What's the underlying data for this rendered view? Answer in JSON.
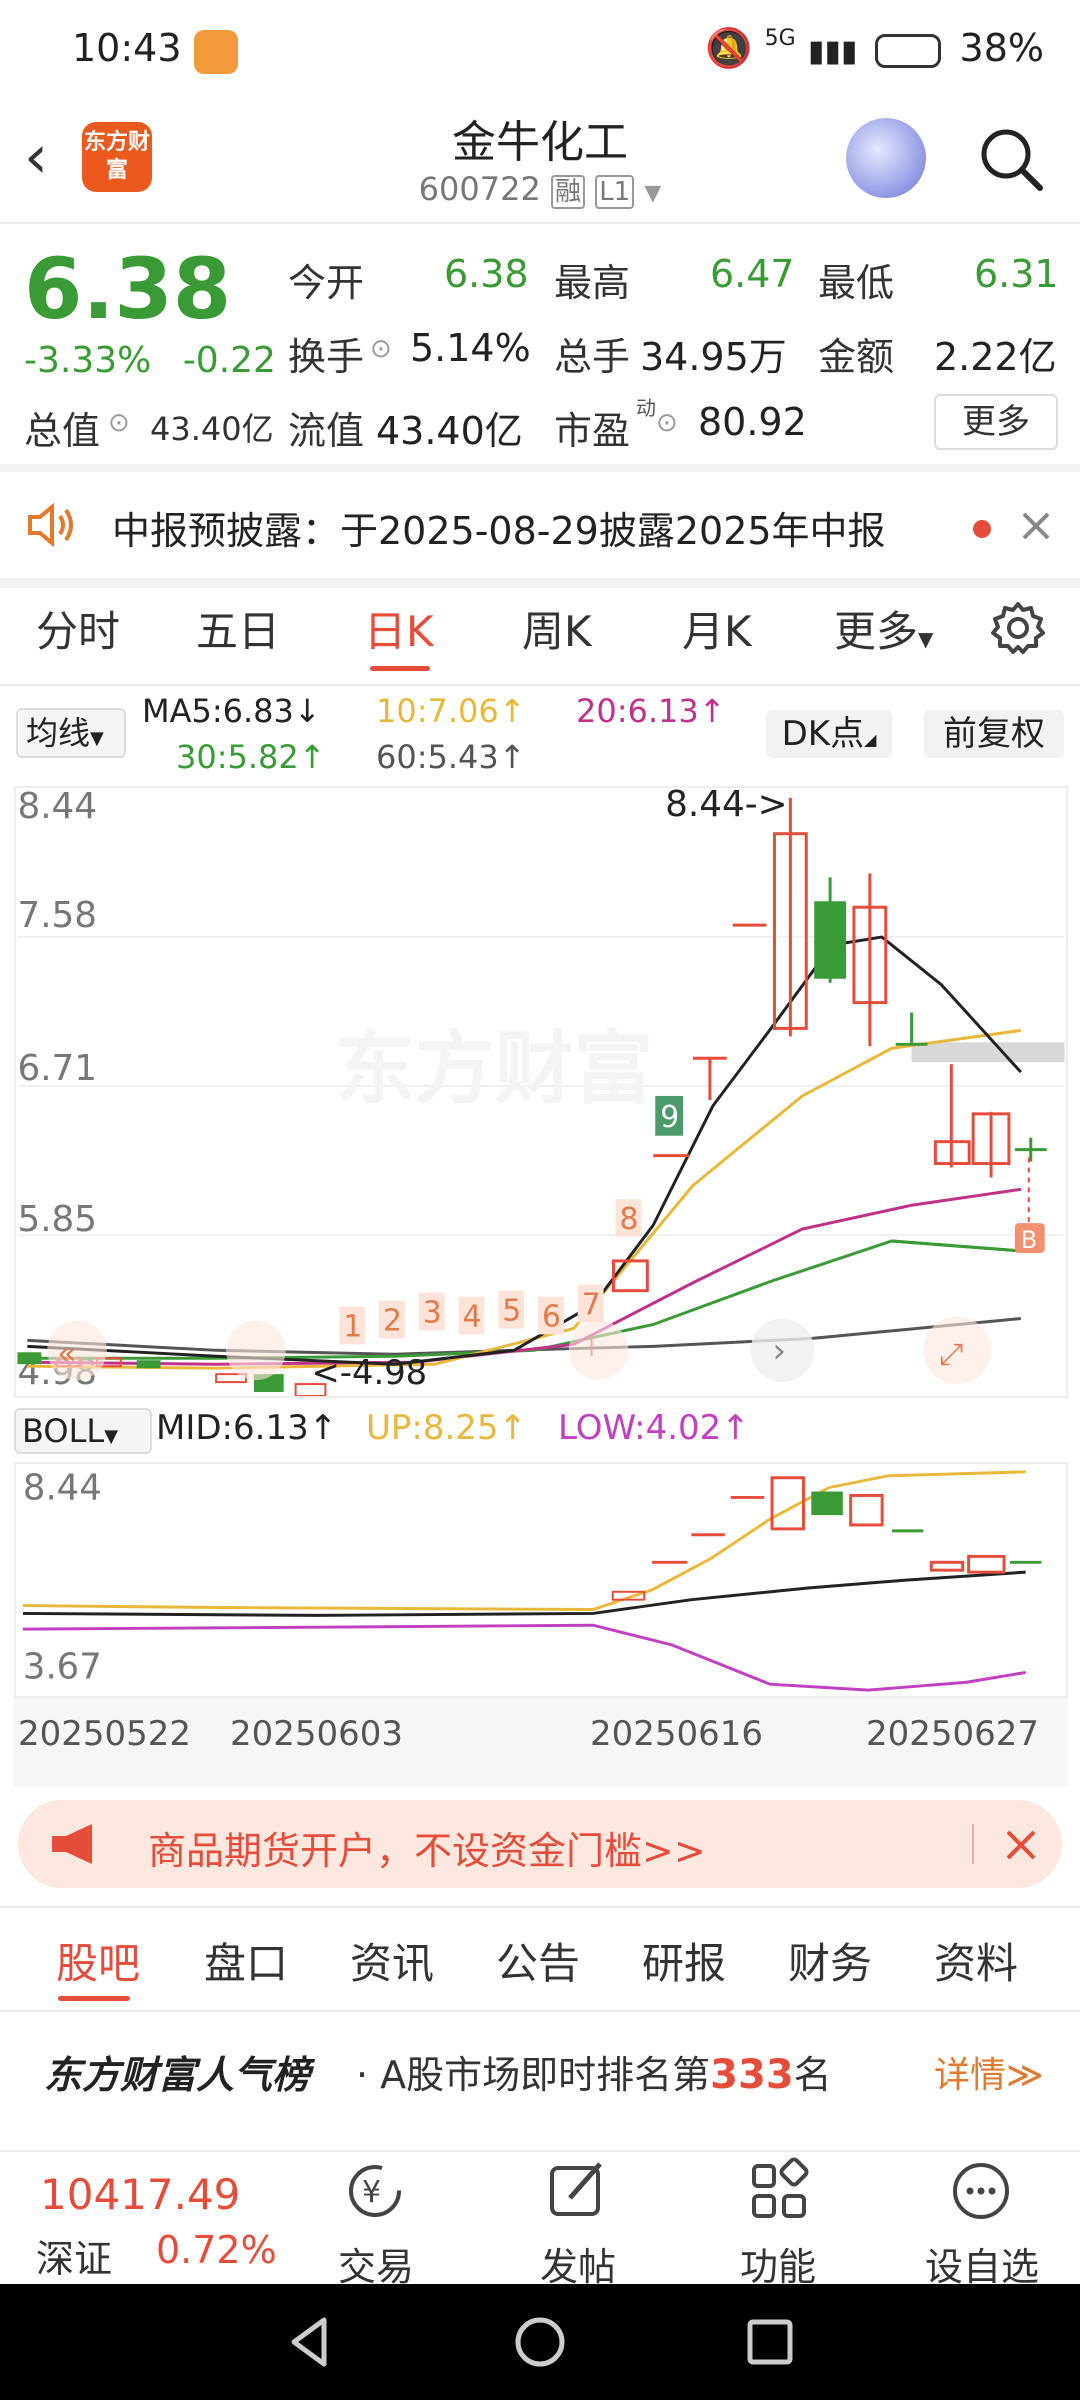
{
  "status_bar": {
    "time": "10:43",
    "battery": "38%",
    "network": "5G"
  },
  "header": {
    "logo_text": "东方财富",
    "stock_name": "金牛化工",
    "stock_code": "600722",
    "tag_margin": "融",
    "tag_level": "L1"
  },
  "quote": {
    "price": "6.38",
    "change_pct": "-3.33%",
    "change_abs": "-0.22",
    "open_label": "今开",
    "open": "6.38",
    "high_label": "最高",
    "high": "6.47",
    "low_label": "最低",
    "low": "6.31",
    "turnover_label": "换手",
    "turnover": "5.14%",
    "volume_label": "总手",
    "volume": "34.95万",
    "amount_label": "金额",
    "amount": "2.22亿",
    "mktcap_label": "总值",
    "mktcap": "43.40亿",
    "float_label": "流值",
    "float_cap": "43.40亿",
    "pe_label": "市盈",
    "pe_sup": "动",
    "pe": "80.92",
    "more_label": "更多"
  },
  "notice": {
    "text": "中报预披露：于2025-08-29披露2025年中报"
  },
  "chart_tabs": [
    "分时",
    "五日",
    "日K",
    "周K",
    "月K",
    "更多"
  ],
  "active_chart_tab": "日K",
  "ma_bar": {
    "selector": "均线",
    "ma5": "MA5:6.83↓",
    "ma10": "10:7.06↑",
    "ma20": "20:6.13↑",
    "ma30": "30:5.82↑",
    "ma60": "60:5.43↑",
    "dk_button": "DK点",
    "adjust_button": "前复权"
  },
  "kline": {
    "y_max_label": "8.44",
    "y_labels": [
      "8.44",
      "7.58",
      "6.71",
      "5.85",
      "4.98"
    ],
    "max_annotation": "8.44->",
    "min_annotation": "<-4.98",
    "dk_marks": [
      "1",
      "2",
      "3",
      "4",
      "5",
      "6",
      "7",
      "8",
      "9"
    ],
    "b_mark": "B",
    "watermark": "东方财富"
  },
  "boll_bar": {
    "selector": "BOLL",
    "mid": "MID:6.13↑",
    "up": "UP:8.25↑",
    "low": "LOW:4.02↑"
  },
  "boll": {
    "y_top": "8.44",
    "y_bottom": "3.67",
    "dates": [
      "20250522",
      "20250603",
      "20250616",
      "20250627"
    ]
  },
  "ad": {
    "text": "商品期货开户，不设资金门槛>>"
  },
  "bottom_tabs": [
    "股吧",
    "盘口",
    "资讯",
    "公告",
    "研报",
    "财务",
    "资料"
  ],
  "active_bottom_tab": "股吧",
  "rank": {
    "brand": "东方财富人气榜",
    "prefix": "· A股市场即时排名第",
    "number": "333",
    "suffix": "名",
    "detail": "详情≫"
  },
  "index": {
    "value": "10417.49",
    "name": "深证",
    "pct": "0.72%"
  },
  "nav_items": [
    "交易",
    "发帖",
    "功能",
    "设自选"
  ],
  "colors": {
    "up": "#e54c3a",
    "down": "#3a9a35",
    "accent": "#e54c3a"
  }
}
